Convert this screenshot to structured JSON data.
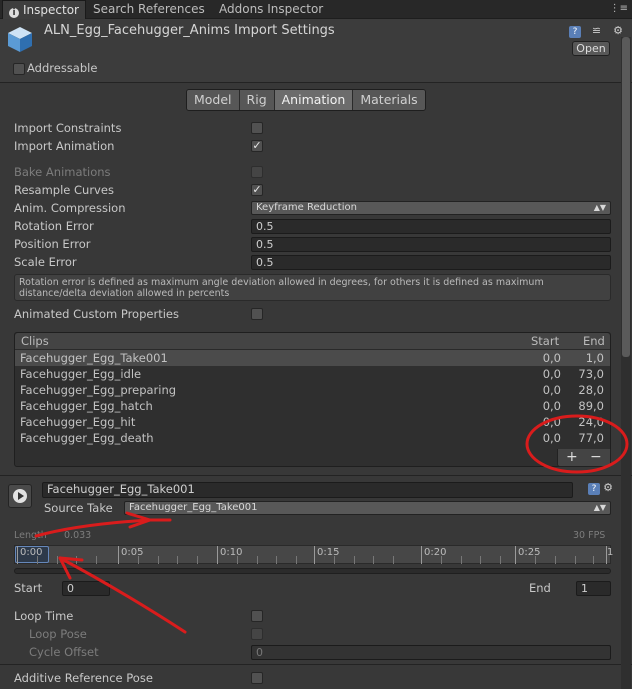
{
  "tabs": [
    {
      "label": "Inspector",
      "icon": "info-icon"
    },
    {
      "label": "Search References"
    },
    {
      "label": "Addons Inspector"
    }
  ],
  "header": {
    "title": "ALN_Egg_Facehugger_Anims Import Settings",
    "open_label": "Open",
    "addressable_label": "Addressable"
  },
  "mode_tabs": [
    "Model",
    "Rig",
    "Animation",
    "Materials"
  ],
  "settings": {
    "import_constraints": "Import Constraints",
    "import_animation": "Import Animation",
    "bake_animations": "Bake Animations",
    "resample_curves": "Resample Curves",
    "anim_compression": "Anim. Compression",
    "anim_compression_value": "Keyframe Reduction",
    "rotation_error": "Rotation Error",
    "rotation_error_value": "0.5",
    "position_error": "Position Error",
    "position_error_value": "0.5",
    "scale_error": "Scale Error",
    "scale_error_value": "0.5",
    "help_text_1": "Rotation error is defined as maximum angle deviation allowed in degrees, for others it is defined as maximum",
    "help_text_2": "distance/delta deviation allowed in percents",
    "animated_custom_properties": "Animated Custom Properties"
  },
  "clips": {
    "header_clips": "Clips",
    "header_start": "Start",
    "header_end": "End",
    "rows": [
      {
        "name": "Facehugger_Egg_Take001",
        "start": "0,0",
        "end": "1,0"
      },
      {
        "name": "Facehugger_Egg_idle",
        "start": "0,0",
        "end": "73,0"
      },
      {
        "name": "Facehugger_Egg_preparing",
        "start": "0,0",
        "end": "28,0"
      },
      {
        "name": "Facehugger_Egg_hatch",
        "start": "0,0",
        "end": "89,0"
      },
      {
        "name": "Facehugger_Egg_hit",
        "start": "0,0",
        "end": "24,0"
      },
      {
        "name": "Facehugger_Egg_death",
        "start": "0,0",
        "end": "77,0"
      }
    ],
    "plus": "+",
    "minus": "−"
  },
  "clip_detail": {
    "name": "Facehugger_Egg_Take001",
    "source_take_label": "Source Take",
    "source_take_value": "Facehugger_Egg_Take001",
    "length_label": "Length",
    "length_value": "0.033",
    "fps": "30 FPS",
    "timeline_labels": [
      "0:00",
      "0:05",
      "0:10",
      "0:15",
      "0:20",
      "0:25",
      "1"
    ],
    "start_label": "Start",
    "start_value": "0",
    "end_label": "End",
    "end_value": "1",
    "loop_time": "Loop Time",
    "loop_pose": "Loop Pose",
    "cycle_offset": "Cycle Offset",
    "cycle_offset_value": "0",
    "additive_reference_pose": "Additive Reference Pose"
  },
  "colors": {
    "annotation": "#d91c1c",
    "selected_tab": "#6c6c6c"
  }
}
